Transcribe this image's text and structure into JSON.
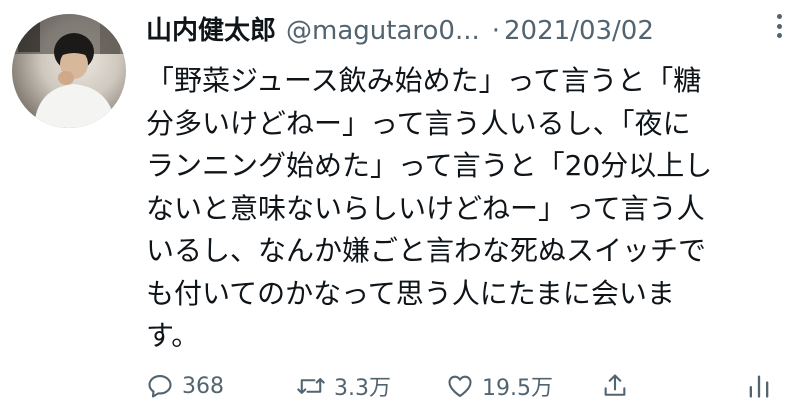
{
  "author": {
    "display_name": "山内健太郎",
    "handle": "@magutaro0...",
    "date": "2021/03/02",
    "separator": "·"
  },
  "tweet": {
    "lines": [
      "「野菜ジュース飲み始めた」って言うと「糖",
      "分多いけどねー」って言う人いるし、「夜に",
      "ランニング始めた」って言うと「20分以上し",
      "ないと意味ないらしいけどねー」って言う人",
      "いるし、なんか嫌ごと言わな死ぬスイッチで",
      "も付いてのかなって思う人にたまに会いま",
      "す。"
    ]
  },
  "actions": {
    "reply": {
      "icon": "reply-icon",
      "count": "368"
    },
    "retweet": {
      "icon": "retweet-icon",
      "count": "3.3万"
    },
    "like": {
      "icon": "heart-icon",
      "count": "19.5万"
    },
    "share": {
      "icon": "share-icon"
    },
    "stats": {
      "icon": "stats-icon"
    }
  },
  "colors": {
    "text": "#0f1419",
    "secondary": "#536471",
    "background": "#ffffff"
  }
}
